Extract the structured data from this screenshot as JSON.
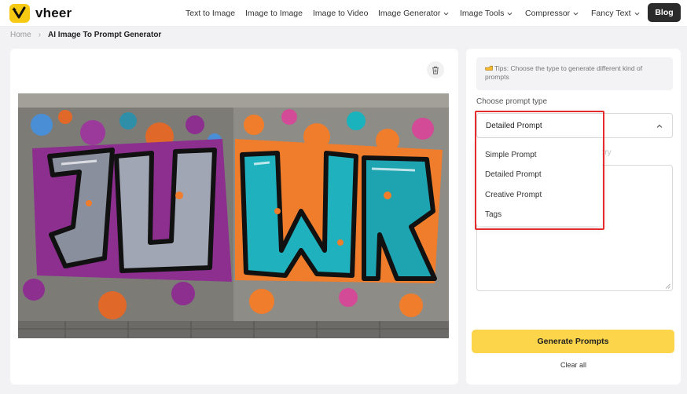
{
  "brand": {
    "name": "vheer",
    "accent": "#f6c913"
  },
  "nav": {
    "items": [
      {
        "label": "Text to Image",
        "dropdown": false
      },
      {
        "label": "Image to Image",
        "dropdown": false
      },
      {
        "label": "Image to Video",
        "dropdown": false
      },
      {
        "label": "Image Generator",
        "dropdown": true
      },
      {
        "label": "Image Tools",
        "dropdown": true
      },
      {
        "label": "Compressor",
        "dropdown": true
      },
      {
        "label": "Fancy Text",
        "dropdown": true
      }
    ],
    "blog_label": "Blog"
  },
  "breadcrumb": {
    "home": "Home",
    "separator": "›",
    "current": "AI Image To Prompt Generator"
  },
  "left_panel": {
    "delete_icon": "trash-icon",
    "preview_image_label": "JUVER graffiti"
  },
  "right_panel": {
    "tips": "Tips: Choose the type to generate different kind of prompts",
    "choose_label": "Choose prompt type",
    "select": {
      "value": "Detailed Prompt",
      "expanded": true
    },
    "options": [
      "Simple Prompt",
      "Detailed Prompt",
      "Creative Prompt",
      "Tags"
    ],
    "history_hint": "tory",
    "prompt_text": "",
    "generate_label": "Generate Prompts",
    "clear_label": "Clear all"
  },
  "colors": {
    "highlight": "#e52b2b",
    "generate_button": "#fdd54a",
    "blog_button": "#2b2b2b"
  }
}
